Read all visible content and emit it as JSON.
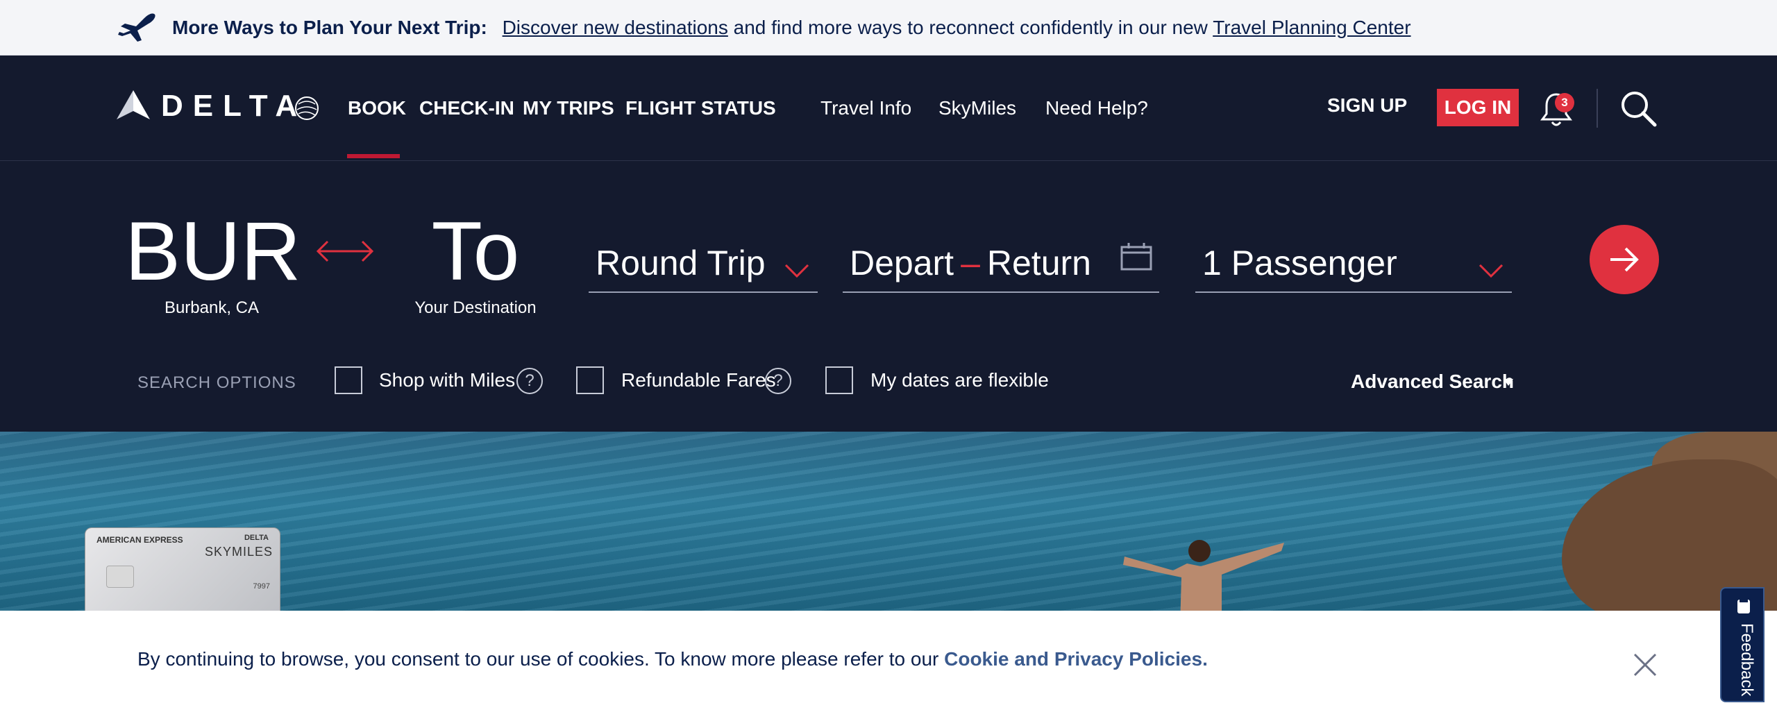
{
  "banner": {
    "icon": "airplane-icon",
    "headline": "More Ways to Plan Your Next Trip:",
    "link1": "Discover new destinations",
    "middle_text": "and find more ways to reconnect confidently in our new",
    "link2": "Travel Planning Center"
  },
  "brand": {
    "name": "DELTA",
    "color_red": "#e0313f",
    "color_navy": "#141a2e"
  },
  "nav": {
    "primary": [
      "BOOK",
      "CHECK-IN",
      "MY TRIPS",
      "FLIGHT STATUS"
    ],
    "secondary": [
      "Travel Info",
      "SkyMiles",
      "Need Help?"
    ],
    "active": "BOOK",
    "sign_up": "SIGN UP",
    "log_in": "LOG IN",
    "notification_count": "3"
  },
  "booking": {
    "origin_code": "BUR",
    "origin_city": "Burbank, CA",
    "dest_code": "To",
    "dest_label": "Your Destination",
    "trip_type": "Round Trip",
    "depart": "Depart",
    "return": "Return",
    "passengers": "1 Passenger",
    "search_options_label": "SEARCH OPTIONS",
    "options": [
      "Shop with Miles",
      "Refundable Fares",
      "My dates are flexible"
    ],
    "advanced_search": "Advanced Search"
  },
  "promo_card": {
    "issuer": "AMERICAN EXPRESS",
    "brand": "DELTA",
    "product": "SKYMILES",
    "digits": "7997"
  },
  "cookie": {
    "message": "By continuing to browse, you consent to our use of cookies. To know more please refer to our",
    "link": "Cookie and Privacy Policies."
  },
  "feedback": {
    "label": "Feedback"
  }
}
